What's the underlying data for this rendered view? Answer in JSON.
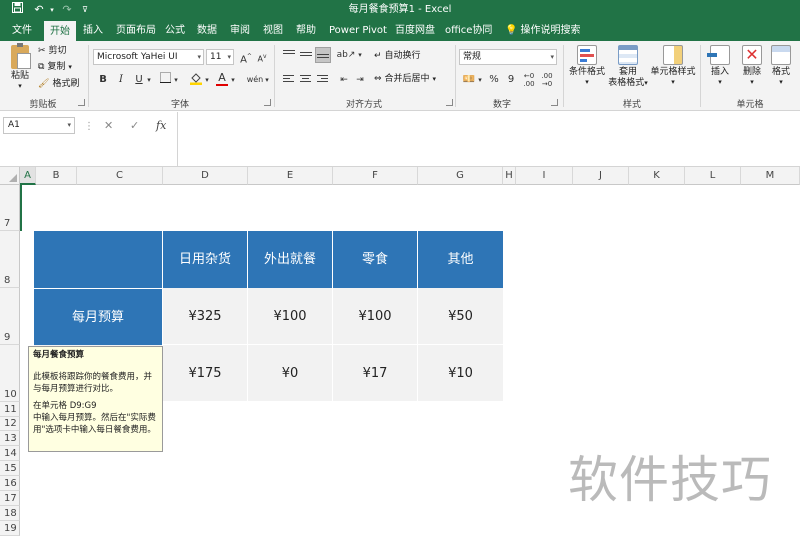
{
  "title_bar": {
    "title": "每月餐食预算1  -  Excel",
    "quick_access": [
      "save-icon",
      "undo-icon",
      "redo-icon",
      "customize-icon"
    ]
  },
  "tabs": [
    {
      "label": "文件"
    },
    {
      "label": "开始"
    },
    {
      "label": "插入"
    },
    {
      "label": "页面布局"
    },
    {
      "label": "公式"
    },
    {
      "label": "数据"
    },
    {
      "label": "审阅"
    },
    {
      "label": "视图"
    },
    {
      "label": "帮助"
    },
    {
      "label": "Power Pivot"
    },
    {
      "label": "百度网盘"
    },
    {
      "label": "office协同"
    }
  ],
  "tell_me": "操作说明搜索",
  "ribbon": {
    "clipboard": {
      "paste": "粘贴",
      "cut": "剪切",
      "copy": "复制",
      "format_painter": "格式刷",
      "group": "剪贴板"
    },
    "font": {
      "name": "Microsoft YaHei UI",
      "size": "11",
      "bold": "B",
      "italic": "I",
      "underline": "U",
      "grow": "A",
      "shrink": "A",
      "font_color_letter": "A",
      "phonetic": "wén",
      "group": "字体"
    },
    "alignment": {
      "wrap": "自动换行",
      "merge": "合并后居中",
      "group": "对齐方式"
    },
    "number": {
      "format": "常规",
      "percent": "%",
      "comma": "9",
      "group": "数字"
    },
    "styles": {
      "conditional": "条件格式",
      "table_line1": "套用",
      "table_line2": "表格格式",
      "cell_styles": "单元格样式",
      "group": "样式"
    },
    "cells": {
      "insert": "插入",
      "delete": "删除",
      "format": "格式",
      "group": "单元格"
    }
  },
  "formula_bar": {
    "name_box": "A1",
    "cancel": "✕",
    "enter": "✓",
    "fx": "fx",
    "value": ""
  },
  "grid": {
    "columns": [
      "A",
      "B",
      "C",
      "D",
      "E",
      "F",
      "G",
      "H",
      "I",
      "J",
      "K",
      "L",
      "M"
    ],
    "selected_column": "A",
    "rows": [
      "7",
      "8",
      "9",
      "10",
      "11",
      "12",
      "13",
      "14",
      "15",
      "16",
      "17",
      "18",
      "19"
    ]
  },
  "table": {
    "headers": [
      "",
      "日用杂货",
      "外出就餐",
      "零食",
      "其他"
    ],
    "budget_label": "每月预算",
    "budget_values": [
      "¥325",
      "¥100",
      "¥100",
      "¥50"
    ],
    "actual_values": [
      "¥175",
      "¥0",
      "¥17",
      "¥10"
    ]
  },
  "comment": {
    "title": "每月餐食预算",
    "line1": "此模板将跟踪你的餐食费用，并",
    "line2": "与每月预算进行对比。",
    "line3": "在单元格 D9:G9",
    "line4": "中输入每月预算。然后在\"实际费",
    "line5": "用\"选项卡中输入每日餐食费用。"
  },
  "watermark": "软件技巧",
  "colors": {
    "excel_green": "#217346",
    "header_blue": "#2e75b6",
    "data_gray": "#f2f2f2",
    "comment_yellow": "#ffffe1"
  }
}
